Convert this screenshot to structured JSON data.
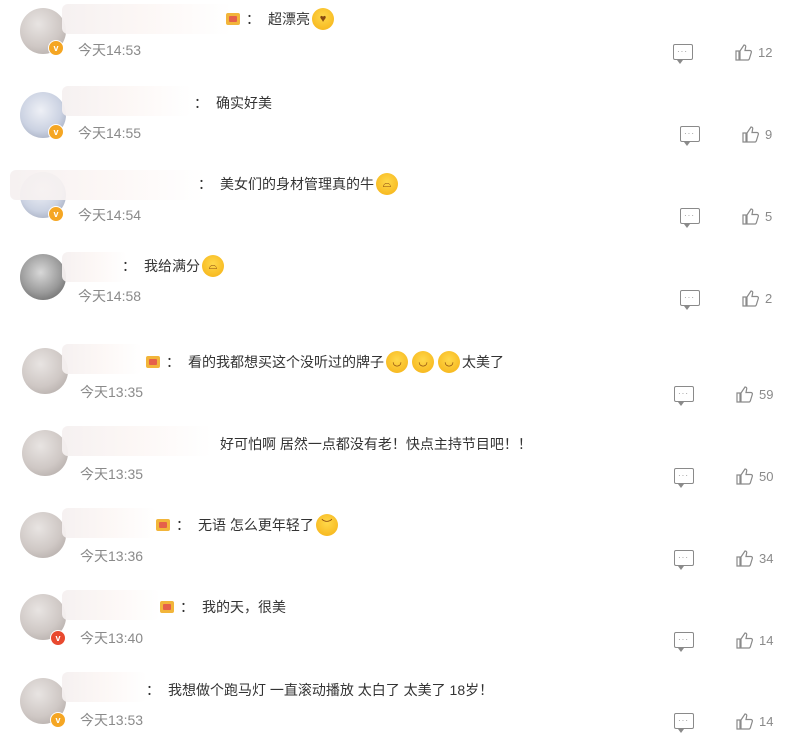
{
  "comments": [
    {
      "text": "超漂亮",
      "time": "今天14:53",
      "likes": "12",
      "emoji_after": [
        "heart-eyes-emoji"
      ],
      "crown": true
    },
    {
      "text": "确实好美",
      "time": "今天14:55",
      "likes": "9",
      "emoji_after": [],
      "crown": false
    },
    {
      "text": "美女们的身材管理真的牛",
      "time": "今天14:54",
      "likes": "5",
      "emoji_after": [
        "crying-emoji"
      ],
      "crown": false
    },
    {
      "text": "我给满分",
      "time": "今天14:58",
      "likes": "2",
      "emoji_after": [
        "crying-emoji"
      ],
      "crown": false
    },
    {
      "text": "看的我都想买这个没听过的牌子",
      "time": "今天13:35",
      "likes": "59",
      "emoji_after": [
        "laughing-emoji",
        "laughing-emoji",
        "laughing-emoji"
      ],
      "text_tail": "太美了",
      "crown": true
    },
    {
      "text": "好可怕啊 居然一点都没有老！快点主持节目吧！！",
      "time": "今天13:35",
      "likes": "50",
      "emoji_after": [],
      "crown": false
    },
    {
      "text": "无语 怎么更年轻了",
      "time": "今天13:36",
      "likes": "34",
      "emoji_after": [
        "sweat-emoji"
      ],
      "crown": true
    },
    {
      "text": "我的天，很美",
      "time": "今天13:40",
      "likes": "14",
      "emoji_after": [],
      "crown": true
    },
    {
      "text": "我想做个跑马灯 一直滚动播放 太白了 太美了 18岁！",
      "time": "今天13:53",
      "likes": "14",
      "emoji_after": [],
      "crown": false
    }
  ],
  "colon": "：",
  "icons": {
    "reply": "comment-icon",
    "like": "thumbs-up-icon",
    "verified": "verified-badge-icon"
  },
  "colors": {
    "badge_orange": "#f5a623",
    "badge_red": "#e8492f",
    "meta_gray": "#8a8a8a"
  }
}
